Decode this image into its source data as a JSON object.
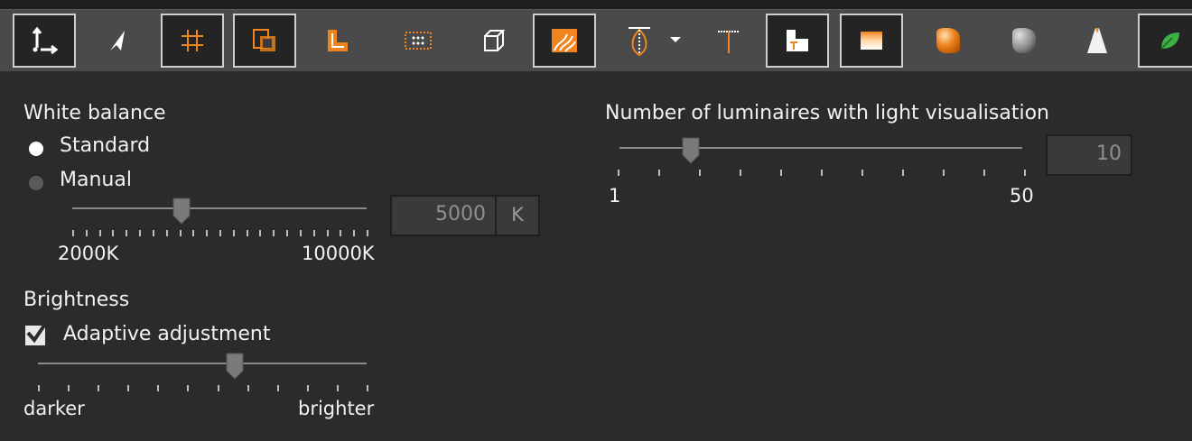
{
  "toolbar": {
    "buttons": [
      {
        "icon": "axis-arrows-icon",
        "selected": true
      },
      {
        "icon": "cursor-arrow-icon",
        "selected": false
      },
      {
        "icon": "grid-hash-icon",
        "selected": true
      },
      {
        "icon": "crop-frame-icon",
        "selected": true
      },
      {
        "icon": "l-shape-icon",
        "selected": false
      },
      {
        "icon": "dotted-rectangle-icon",
        "selected": false
      },
      {
        "icon": "wireframe-cube-icon",
        "selected": false
      },
      {
        "icon": "wood-texture-icon",
        "selected": true
      },
      {
        "icon": "light-cone-dropdown-icon",
        "selected": false
      },
      {
        "icon": "spot-lamp-icon",
        "selected": false
      },
      {
        "icon": "floor-plan-icon",
        "selected": true
      },
      {
        "icon": "gradient-fill-icon",
        "selected": true
      },
      {
        "icon": "orange-render-icon",
        "selected": false
      },
      {
        "icon": "grey-render-icon",
        "selected": false
      },
      {
        "icon": "light-beam-icon",
        "selected": false
      },
      {
        "icon": "green-leaf-icon",
        "selected": true
      }
    ]
  },
  "white_balance": {
    "title": "White balance",
    "options": [
      "Standard",
      "Manual"
    ],
    "selected": "Standard",
    "slider": {
      "min_label": "2000K",
      "max_label": "10000K",
      "value": 5000
    },
    "value": "5000",
    "unit": "K"
  },
  "brightness": {
    "title": "Brightness",
    "adaptive_label": "Adaptive adjustment",
    "adaptive_checked": true,
    "slider": {
      "min_label": "darker",
      "max_label": "brighter",
      "level": 0.6
    }
  },
  "luminaires": {
    "title": "Number of luminaires with light visualisation",
    "slider": {
      "min_label": "1",
      "max_label": "50",
      "value": 10
    },
    "value": "10"
  },
  "colors": {
    "accent": "#f0841e",
    "background": "#2b2b2b",
    "toolbar": "#4a4a4a"
  }
}
